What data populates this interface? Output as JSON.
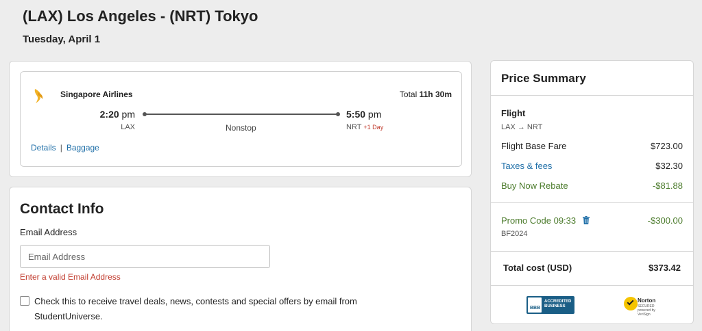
{
  "header": {
    "title": "(LAX) Los Angeles - (NRT) Tokyo",
    "date": "Tuesday, April 1"
  },
  "flight": {
    "airline": "Singapore Airlines",
    "total_label": "Total",
    "total_duration": "11h 30m",
    "departure": {
      "time": "2:20",
      "period": "pm",
      "code": "LAX"
    },
    "arrival": {
      "time": "5:50",
      "period": "pm",
      "code": "NRT",
      "day_offset": "+1 Day"
    },
    "stops": "Nonstop",
    "details_link": "Details",
    "separator": "|",
    "baggage_link": "Baggage"
  },
  "contact": {
    "title": "Contact Info",
    "email_label": "Email Address",
    "email_placeholder": "Email Address",
    "email_value": "",
    "email_error": "Enter a valid Email Address",
    "opt_in_text": "Check this to receive travel deals, news, contests and special offers by email from StudentUniverse."
  },
  "price_summary": {
    "title": "Price Summary",
    "section_title": "Flight",
    "route": "LAX → NRT",
    "base_fare_label": "Flight Base Fare",
    "base_fare_value": "$723.00",
    "taxes_label": "Taxes & fees",
    "taxes_value": "$32.30",
    "rebate_label": "Buy Now Rebate",
    "rebate_value": "-$81.88",
    "promo_label": "Promo Code 09:33",
    "promo_value": "-$300.00",
    "promo_code": "BF2024",
    "total_label": "Total cost (USD)",
    "total_value": "$373.42"
  },
  "badges": {
    "bbb_seal": "BBB",
    "bbb_text": "ACCREDITED BUSINESS",
    "norton_text": "Norton",
    "norton_sub": "SECURED",
    "norton_powered": "powered by VeriSign"
  },
  "colors": {
    "link_blue": "#1f6fa8",
    "rebate_green": "#4a7a2a",
    "error_red": "#c0392b",
    "bbb_blue": "#1a5e86",
    "norton_yellow": "#f5c400"
  },
  "icons": {
    "airline_logo": "singapore-airlines-bird-icon",
    "promo_remove": "trash-icon"
  }
}
